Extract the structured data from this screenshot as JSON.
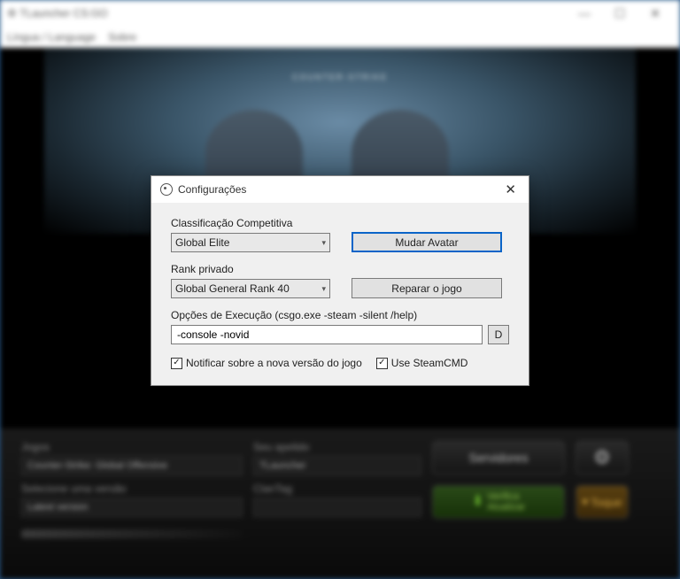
{
  "window": {
    "title": "TLauncher CS:GO",
    "menu": {
      "language": "Língua / Language",
      "about": "Sobre"
    }
  },
  "hero": {
    "logo_text": "COUNTER-STRIKE"
  },
  "bottom": {
    "games_label": "Jogos",
    "games_value": "Counter-Strike: Global Offensive",
    "version_label": "Selecione uma versão",
    "version_value": "Latest version",
    "nick_label": "Seu apelido",
    "nick_value": "TLauncher",
    "clantag_label": "ClanTag",
    "clantag_value": "",
    "servers": "Servidores",
    "verify": "Verifica\nAtualizar",
    "toque": "Toque"
  },
  "dialog": {
    "title": "Configurações",
    "rank_label": "Classificação Competitiva",
    "rank_value": "Global Elite",
    "avatar_btn": "Mudar Avatar",
    "private_label": "Rank privado",
    "private_value": "Global General Rank 40",
    "repair_btn": "Reparar o jogo",
    "launch_label": "Opções de Execução (csgo.exe -steam -silent /help)",
    "launch_value": "-console -novid",
    "d_btn": "D",
    "notify_label": "Notificar sobre a nova versão do jogo",
    "steamcmd_label": "Use SteamCMD",
    "notify_checked": true,
    "steamcmd_checked": true
  }
}
